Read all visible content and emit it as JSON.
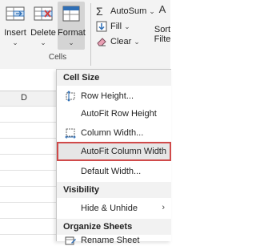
{
  "ribbon": {
    "cells_group": {
      "label": "Cells",
      "buttons": [
        {
          "label": "Insert",
          "caret": "⌄"
        },
        {
          "label": "Delete",
          "caret": "⌄"
        },
        {
          "label": "Format",
          "caret": "⌄"
        }
      ]
    },
    "editing_group": {
      "autosum_label": "AutoSum",
      "autosum_caret": "⌄",
      "fill_label": "Fill",
      "fill_caret": "⌄",
      "clear_label": "Clear",
      "clear_caret": "⌄",
      "sort_icon_text": "A",
      "sort_label": "Sort",
      "sort_label2": "Filte"
    }
  },
  "sheet": {
    "column_header": "D"
  },
  "menu": {
    "sections": [
      {
        "header": "Cell Size",
        "items": [
          {
            "label": "Row Height...",
            "icon": "row-height-icon"
          },
          {
            "label": "AutoFit Row Height",
            "icon": ""
          },
          {
            "label": "Column Width...",
            "icon": "column-width-icon"
          },
          {
            "label": "AutoFit Column Width",
            "icon": "",
            "highlighted": true
          },
          {
            "label": "Default Width...",
            "icon": ""
          }
        ]
      },
      {
        "header": "Visibility",
        "items": [
          {
            "label": "Hide & Unhide",
            "icon": "",
            "submenu": "›"
          }
        ]
      },
      {
        "header": "Organize Sheets",
        "items": [
          {
            "label": "Rename Sheet",
            "icon": "rename-sheet-icon"
          }
        ]
      }
    ]
  },
  "colors": {
    "highlight_border": "#d04a4a",
    "highlight_fill": "#e6e6e6",
    "ribbon_bg": "#f3f3f3",
    "icon_blue": "#2f6fb6",
    "icon_red": "#d13a3a"
  }
}
